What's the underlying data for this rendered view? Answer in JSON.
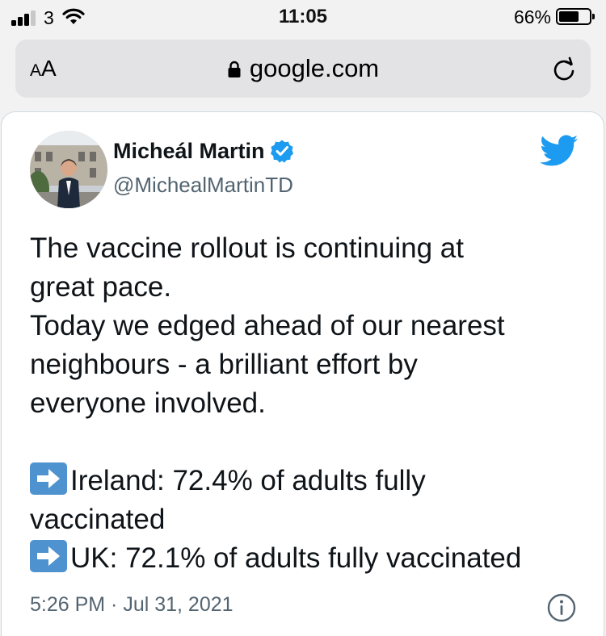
{
  "status_bar": {
    "carrier": "3",
    "time": "11:05",
    "battery_percent": "66%",
    "battery_level": 0.66
  },
  "address_bar": {
    "text_size_small": "A",
    "text_size_large": "A",
    "url": "google.com"
  },
  "tweet": {
    "display_name": "Micheál Martin",
    "handle": "@MichealMartinTD",
    "text_lines": [
      "The vaccine rollout is continuing at",
      "great pace.",
      "Today we edged ahead of our nearest",
      "neighbours - a brilliant effort by",
      "everyone involved."
    ],
    "stats": [
      {
        "line1": "Ireland: 72.4% of adults fully",
        "line2": "vaccinated"
      },
      {
        "line1": "UK: 72.1% of adults fully vaccinated"
      }
    ],
    "timestamp": "5:26 PM · Jul 31, 2021"
  },
  "colors": {
    "twitter_blue": "#1d9bf0",
    "arrow_emoji_bg": "#4f92d0",
    "secondary_text": "#536471"
  },
  "icons": [
    "signal-icon",
    "wifi-icon",
    "battery-icon",
    "lock-icon",
    "reload-icon",
    "verified-badge-icon",
    "twitter-bird-icon",
    "right-arrow-emoji-icon",
    "info-icon"
  ]
}
